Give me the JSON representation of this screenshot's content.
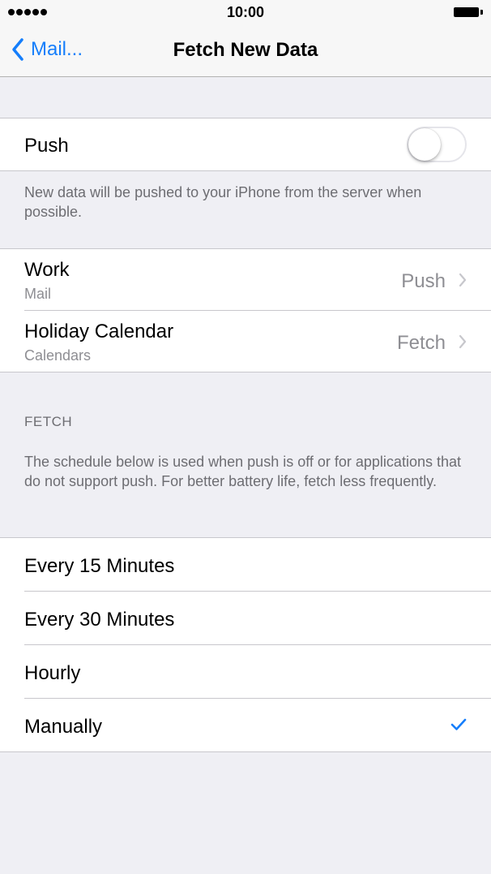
{
  "status_bar": {
    "time": "10:00",
    "signal_icon": "signal-dots-icon",
    "battery_icon": "battery-full-icon"
  },
  "nav": {
    "back_label": "Mail...",
    "back_icon": "chevron-left-icon",
    "title": "Fetch New Data",
    "accent_color": "#157efb"
  },
  "push": {
    "label": "Push",
    "enabled": false,
    "footer": "New data will be pushed to your iPhone from the server when possible."
  },
  "accounts": [
    {
      "name": "Work",
      "type": "Mail",
      "value": "Push"
    },
    {
      "name": "Holiday Calendar",
      "type": "Calendars",
      "value": "Fetch"
    }
  ],
  "fetch": {
    "header": "FETCH",
    "description": "The schedule below is used when push is off or for applications that do not support push. For better battery life, fetch less frequently.",
    "options": [
      {
        "label": "Every 15 Minutes",
        "selected": false
      },
      {
        "label": "Every 30 Minutes",
        "selected": false
      },
      {
        "label": "Hourly",
        "selected": false
      },
      {
        "label": "Manually",
        "selected": true
      }
    ]
  }
}
